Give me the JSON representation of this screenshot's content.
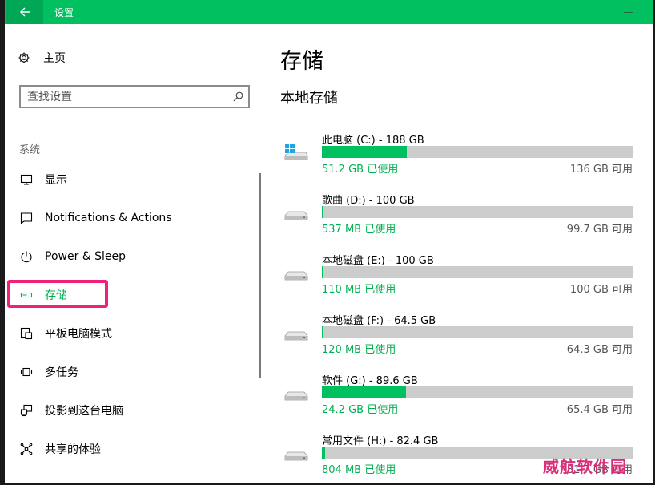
{
  "window": {
    "title": "设置"
  },
  "sidebar": {
    "home_label": "主页",
    "search_placeholder": "查找设置",
    "section": "系统",
    "items": [
      {
        "label": "显示",
        "icon": "monitor-icon"
      },
      {
        "label": "Notifications & Actions",
        "icon": "notification-icon"
      },
      {
        "label": "Power & Sleep",
        "icon": "power-icon"
      },
      {
        "label": "存储",
        "icon": "storage-icon",
        "active": true
      },
      {
        "label": "平板电脑模式",
        "icon": "tablet-mode-icon"
      },
      {
        "label": "多任务",
        "icon": "multitasking-icon"
      },
      {
        "label": "投影到这台电脑",
        "icon": "projection-icon"
      },
      {
        "label": "共享的体验",
        "icon": "shared-experience-icon"
      }
    ]
  },
  "main": {
    "title": "存储",
    "subtitle": "本地存储",
    "drives": [
      {
        "name": "此电脑 (C:) - 188 GB",
        "used": "51.2 GB 已使用",
        "free": "136 GB 可用",
        "fraction": 0.272,
        "icon": "windows-drive-icon"
      },
      {
        "name": "歌曲 (D:) - 100 GB",
        "used": "537 MB 已使用",
        "free": "99.7 GB 可用",
        "fraction": 0.005,
        "icon": "drive-icon"
      },
      {
        "name": "本地磁盘 (E:) - 100 GB",
        "used": "110 MB 已使用",
        "free": "100 GB 可用",
        "fraction": 0.001,
        "icon": "drive-icon"
      },
      {
        "name": "本地磁盘 (F:) - 64.5 GB",
        "used": "120 MB 已使用",
        "free": "64.3 GB 可用",
        "fraction": 0.002,
        "icon": "drive-icon"
      },
      {
        "name": "软件 (G:) - 89.6 GB",
        "used": "24.2 GB 已使用",
        "free": "65.4 GB 可用",
        "fraction": 0.27,
        "icon": "drive-icon"
      },
      {
        "name": "常用文件 (H:) - 82.4 GB",
        "used": "804 MB 已使用",
        "free": "81.7 GB 可用",
        "fraction": 0.01,
        "icon": "drive-icon"
      }
    ]
  },
  "watermark": "威航软件园",
  "colors": {
    "accent": "#00c060",
    "highlight": "#f0217a",
    "bar_track": "#cccccc"
  }
}
